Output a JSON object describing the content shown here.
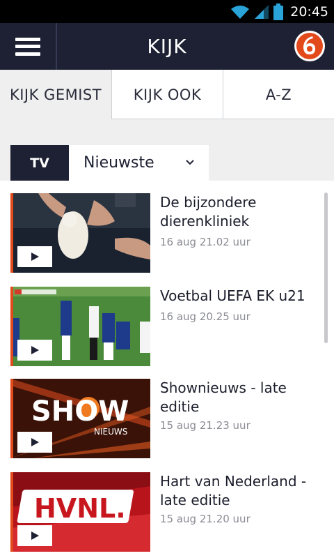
{
  "status_bar": {
    "time": "20:45",
    "icons": [
      "wifi-icon",
      "signal-icon",
      "battery-icon"
    ]
  },
  "app_bar": {
    "title": "KIJK",
    "menu_icon": "hamburger-menu-icon",
    "logo": "sbs6-logo"
  },
  "tabs": [
    {
      "label": "KIJK GEMIST",
      "active": true
    },
    {
      "label": "KIJK OOK",
      "active": false
    },
    {
      "label": "A-Z",
      "active": false
    }
  ],
  "filter": {
    "channel": "TV",
    "sort_value": "Nieuwste"
  },
  "videos": [
    {
      "title": "De bijzondere dierenkliniek",
      "date": "16 aug 21.02 uur"
    },
    {
      "title": "Voetbal UEFA EK u21",
      "date": "16 aug 20.25 uur"
    },
    {
      "title": "Shownieuws - late editie",
      "date": "15 aug 21.23 uur"
    },
    {
      "title": "Hart van Nederland - late editie",
      "date": "15 aug 21.20 uur"
    }
  ],
  "thumbnail_text": {
    "show_top": "SHOW",
    "show_sub": "NIEUWS",
    "hvnl": "HVNL."
  },
  "colors": {
    "app_bar": "#1e2133",
    "accent": "#e24a1c",
    "background": "#efefef"
  }
}
